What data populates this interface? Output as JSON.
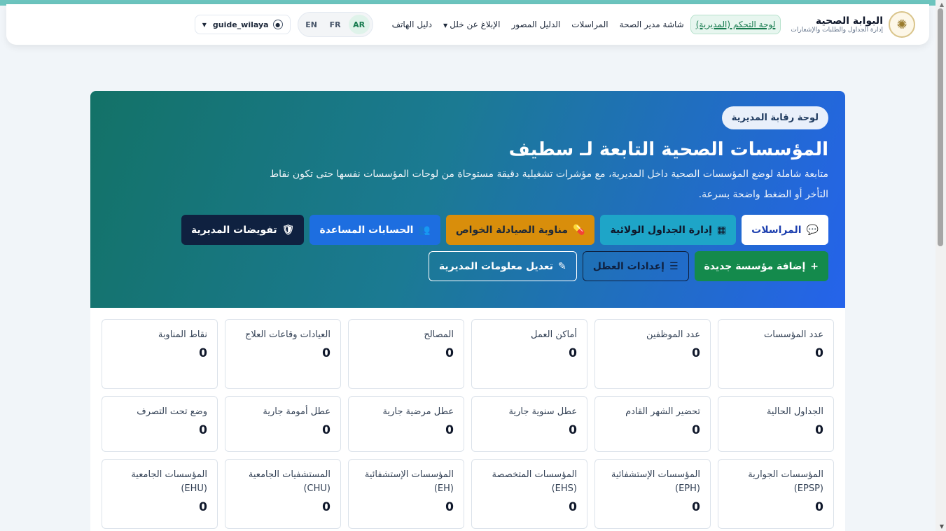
{
  "brand": {
    "title": "البوابة الصحية",
    "subtitle": "إدارة الجداول والطلبات والإشعارات"
  },
  "nav": {
    "links": [
      {
        "label": "لوحة التحكم (المديرية)",
        "active": true
      },
      {
        "label": "شاشة مدير الصحة"
      },
      {
        "label": "المراسلات"
      },
      {
        "label": "الدليل المصور"
      },
      {
        "label": "الإبلاغ عن خلل"
      },
      {
        "label": "دليل الهاتف"
      }
    ],
    "languages": [
      "AR",
      "FR",
      "EN"
    ],
    "active_language": "AR",
    "user": "guide_wilaya"
  },
  "hero": {
    "badge": "لوحة رقابة المديرية",
    "title": "المؤسسات الصحية التابعة لـ سطيف",
    "description": "متابعة شاملة لوضع المؤسسات الصحية داخل المديرية، مع مؤشرات تشغيلية دقيقة مستوحاة من لوحات المؤسسات نفسها حتى تكون نقاط التأخر أو الضغط واضحة بسرعة.",
    "buttons_row1": [
      {
        "label": "المراسلات",
        "icon": "chat-icon"
      },
      {
        "label": "إدارة الجداول الولائية",
        "icon": "calendar-icon"
      },
      {
        "label": "مناوبة الصيادلة الخواص",
        "icon": "pill-icon"
      },
      {
        "label": "الحسابات المساعدة",
        "icon": "users-icon"
      },
      {
        "label": "تفويضات المديرية",
        "icon": "shield-icon"
      }
    ],
    "buttons_row2": [
      {
        "label": "إضافة مؤسسة جديدة",
        "icon": "plus-icon"
      },
      {
        "label": "إعدادات العطل",
        "icon": "sliders-icon"
      },
      {
        "label": "تعديل معلومات المديرية",
        "icon": "edit-icon"
      }
    ]
  },
  "stats": {
    "row1": [
      {
        "label": "عدد المؤسسات",
        "value": "0"
      },
      {
        "label": "عدد الموظفين",
        "value": "0"
      },
      {
        "label": "أماكن العمل",
        "value": "0"
      },
      {
        "label": "المصالح",
        "value": "0"
      },
      {
        "label": "العيادات وقاعات العلاج",
        "value": "0"
      },
      {
        "label": "نقاط المناوبة",
        "value": "0"
      }
    ],
    "row2": [
      {
        "label": "الجداول الحالية",
        "value": "0"
      },
      {
        "label": "تحضير الشهر القادم",
        "value": "0"
      },
      {
        "label": "عطل سنوية جارية",
        "value": "0"
      },
      {
        "label": "عطل مرضية جارية",
        "value": "0"
      },
      {
        "label": "عطل أمومة جارية",
        "value": "0"
      },
      {
        "label": "وضع تحت التصرف",
        "value": "0"
      }
    ],
    "row3": [
      {
        "label": "المؤسسات الجوارية (EPSP)",
        "value": "0"
      },
      {
        "label": "المؤسسات الإستشفائية (EPH)",
        "value": "0"
      },
      {
        "label": "المؤسسات المتخصصة (EHS)",
        "value": "0"
      },
      {
        "label": "المؤسسات الإستشفائية (EH)",
        "value": "0"
      },
      {
        "label": "المستشفيات الجامعية (CHU)",
        "value": "0"
      },
      {
        "label": "المؤسسات الجامعية (EHU)",
        "value": "0"
      }
    ]
  }
}
